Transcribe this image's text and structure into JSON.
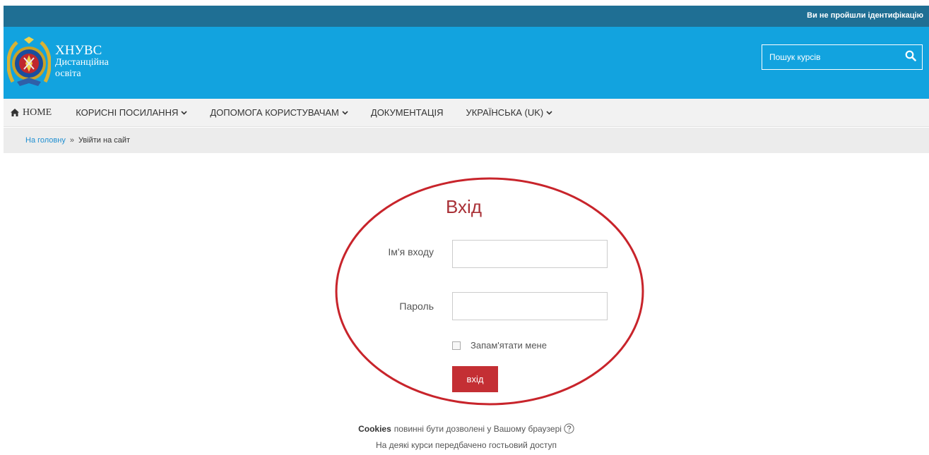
{
  "topbar": {
    "login_status": "Ви не пройшли ідентифікацію"
  },
  "header": {
    "site_name_line1": "ХНУВС",
    "site_name_line2": "Дистанційна",
    "site_name_line3": "освіта",
    "search_placeholder": "Пошук курсів",
    "icons": {
      "logo": "university-emblem",
      "search": "search-icon"
    }
  },
  "nav": {
    "items": [
      {
        "label": "HOME",
        "icon": "home-icon"
      },
      {
        "label": "КОРИСНІ ПОСИЛАННЯ",
        "dropdown": true
      },
      {
        "label": "ДОПОМОГА КОРИСТУВАЧАМ",
        "dropdown": true
      },
      {
        "label": "ДОКУМЕНТАЦІЯ"
      },
      {
        "label": "УКРАЇНСЬКА (UK)",
        "dropdown": true
      }
    ]
  },
  "breadcrumb": {
    "home": "На головну",
    "separator": "»",
    "current": "Увійти на сайт"
  },
  "login": {
    "title": "Вхід",
    "username_label": "Ім'я входу",
    "username_value": "",
    "password_label": "Пароль",
    "password_value": "",
    "remember_label": "Запам'ятати мене",
    "remember_checked": false,
    "button_label": "вхід"
  },
  "footer": {
    "cookies_bold": "Cookies",
    "cookies_text": "повинні бути дозволені у Вашому браузері",
    "guest_text": "На деякі курси передбачено гостьовий доступ"
  },
  "colors": {
    "header_bg": "#12a3df",
    "topbar_bg": "#1f6f94",
    "accent_red": "#c42f34",
    "title_red": "#a93137",
    "link_blue": "#1f8fd1"
  }
}
